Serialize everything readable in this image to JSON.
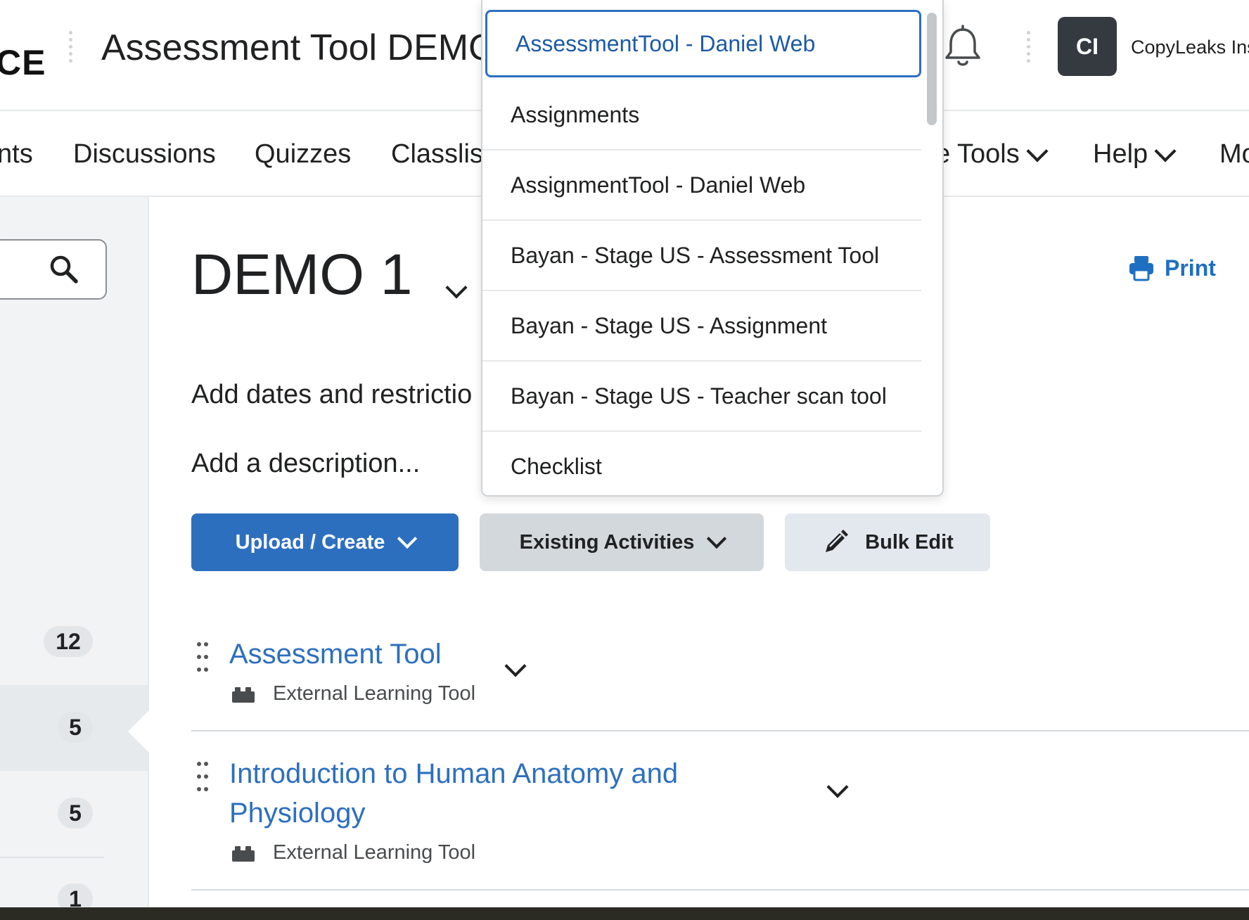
{
  "header": {
    "logo_fragment": "CE",
    "course_title": "Assessment Tool DEMO",
    "user_initials": "CI",
    "user_name": "CopyLeaks Ins"
  },
  "nav": {
    "items": [
      {
        "label": "nts"
      },
      {
        "label": "Discussions"
      },
      {
        "label": "Quizzes"
      },
      {
        "label": "Classlis"
      },
      {
        "label": "e Tools"
      },
      {
        "label": "Help"
      },
      {
        "label": "Mo"
      }
    ]
  },
  "sidebar": {
    "badges": [
      "12",
      "5",
      "5",
      "1"
    ]
  },
  "main": {
    "unit_title": "DEMO 1",
    "print_label": "Print",
    "add_dates": "Add dates and restrictio",
    "add_description": "Add a description...",
    "buttons": {
      "upload_create": "Upload / Create",
      "existing_activities": "Existing Activities",
      "bulk_edit": "Bulk Edit"
    },
    "activities": [
      {
        "title": "Assessment Tool",
        "type": "External Learning Tool"
      },
      {
        "title": "Introduction to Human Anatomy and Physiology",
        "type": "External Learning Tool"
      }
    ]
  },
  "dropdown": {
    "selected": "AssessmentTool - Daniel Web",
    "options": [
      "AssessmentTool - Daniel Web",
      "Assignments",
      "AssignmentTool - Daniel Web",
      "Bayan - Stage US - Assessment Tool",
      "Bayan - Stage US - Assignment",
      "Bayan - Stage US - Teacher scan tool",
      "Checklist"
    ]
  },
  "colors": {
    "accent": "#2d6fbf",
    "secondary_button": "#d3d8dd",
    "sidebar_bg": "#f1f3f5"
  }
}
